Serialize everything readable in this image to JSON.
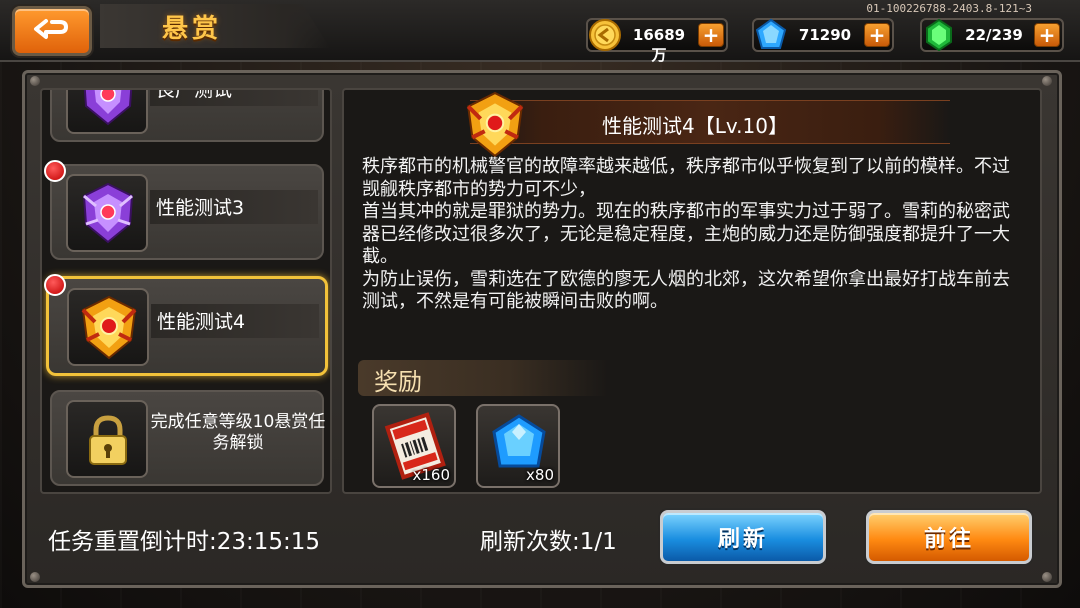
{
  "header": {
    "title": "悬赏",
    "server_id": "01-100226788-2403.8-121~3"
  },
  "resources": [
    {
      "icon": "gold-coin-icon",
      "value": "16689万"
    },
    {
      "icon": "blue-diamond-icon",
      "value": "71290"
    },
    {
      "icon": "green-energy-icon",
      "value": "22/239"
    }
  ],
  "task_list": {
    "items": [
      {
        "label": "良产测试",
        "emblem": "purple-emblem-icon",
        "partial": true
      },
      {
        "label": "性能测试3",
        "emblem": "purple-emblem-icon",
        "has_notice": true
      },
      {
        "label": "性能测试4",
        "emblem": "gold-emblem-icon",
        "has_notice": true,
        "selected": true
      },
      {
        "label": "完成任意等级10悬赏任务解锁",
        "emblem": "lock-icon",
        "locked": true
      }
    ]
  },
  "detail": {
    "title": "性能测试4【Lv.10】",
    "description": [
      "秩序都市的机械警官的故障率越来越低，秩序都市似乎恢复到了以前的模样。不过觊觎秩序都市的势力可不少，",
      "首当其冲的就是罪狱的势力。现在的秩序都市的军事实力过于弱了。雪莉的秘密武器已经修改过很多次了，无论是稳定程度，主炮的威力还是防御强度都提升了一大截。",
      "为防止误伤，雪莉选在了欧德的廖无人烟的北郊，这次希望你拿出最好打战车前去测试，不然是有可能被瞬间击败的啊。"
    ],
    "reward_title": "奖励",
    "rewards": [
      {
        "icon": "ticket-scroll-icon",
        "qty": "x160"
      },
      {
        "icon": "blue-gem-icon",
        "qty": "x80"
      }
    ]
  },
  "footer": {
    "countdown": "任务重置倒计时:23:15:15",
    "refresh_count": "刷新次数:1/1",
    "refresh_label": "刷新",
    "go_label": "前往"
  },
  "colors": {
    "accent_orange": "#ff8a12",
    "accent_blue": "#1a8ee0",
    "title_gold": "#ffc64a",
    "selected_border": "#f2c23a"
  }
}
